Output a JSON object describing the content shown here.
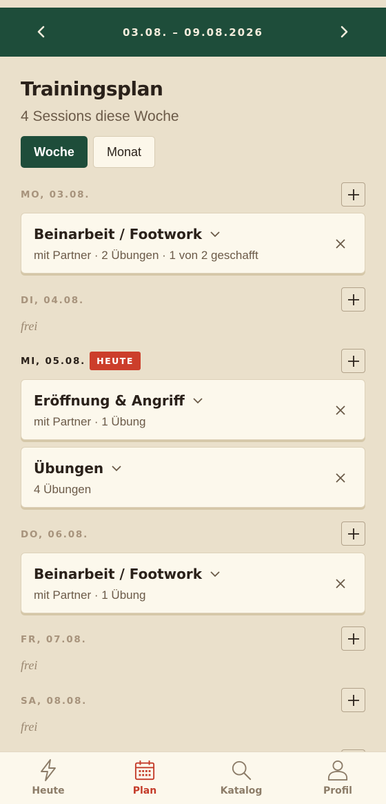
{
  "header": {
    "range": "03.08. – 09.08.2026",
    "prev_icon": "chevron-left-icon",
    "next_icon": "chevron-right-icon"
  },
  "page": {
    "title": "Trainingsplan",
    "subtitle": "4 Sessions diese Woche"
  },
  "view_toggle": {
    "week": "Woche",
    "month": "Monat",
    "selected": "Woche"
  },
  "days": [
    {
      "label": "MO, 03.08.",
      "sessions": [
        {
          "title": "Beinarbeit / Footwork",
          "meta": "mit Partner · 2 Übungen · 1 von 2 geschafft"
        }
      ]
    },
    {
      "label": "DI, 04.08.",
      "free": "frei"
    },
    {
      "label": "MI, 05.08.",
      "badge": "HEUTE",
      "sessions": [
        {
          "title": "Eröffnung & Angriff",
          "meta": "mit Partner · 1 Übung"
        },
        {
          "title": "Übungen",
          "meta": "4 Übungen"
        }
      ]
    },
    {
      "label": "DO, 06.08.",
      "sessions": [
        {
          "title": "Beinarbeit / Footwork",
          "meta": "mit Partner · 1 Übung"
        }
      ]
    },
    {
      "label": "FR, 07.08.",
      "free": "frei"
    },
    {
      "label": "SA, 08.08.",
      "free": "frei"
    }
  ],
  "tabbar": {
    "items": [
      {
        "label": "Heute",
        "icon": "lightning-icon"
      },
      {
        "label": "Plan",
        "icon": "calendar-icon",
        "active": true
      },
      {
        "label": "Katalog",
        "icon": "search-icon"
      },
      {
        "label": "Profil",
        "icon": "user-icon"
      }
    ]
  },
  "colors": {
    "header_bg": "#1e4d3a",
    "page_bg": "#eae0cb",
    "card_bg": "#fcf8ec",
    "today_badge": "#cc3e2b",
    "active_tab": "#c43c2a"
  }
}
